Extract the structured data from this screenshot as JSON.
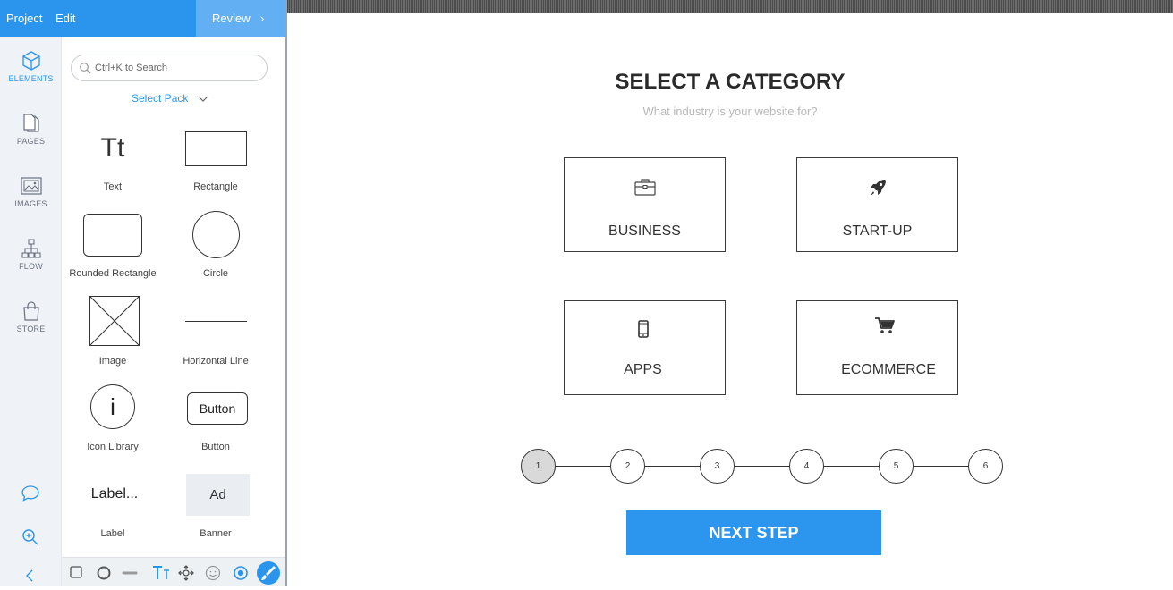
{
  "topbar": {
    "project_label": "Project",
    "edit_label": "Edit",
    "review_label": "Review"
  },
  "rail": {
    "items": [
      {
        "label": "ELEMENTS",
        "icon": "cube-icon",
        "active": true
      },
      {
        "label": "PAGES",
        "icon": "pages-icon"
      },
      {
        "label": "IMAGES",
        "icon": "image-icon"
      },
      {
        "label": "FLOW",
        "icon": "flow-icon"
      },
      {
        "label": "STORE",
        "icon": "bag-icon"
      }
    ],
    "tools": [
      "comment-icon",
      "zoom-icon",
      "collapse-icon"
    ]
  },
  "panel": {
    "search_placeholder": "Ctrl+K to Search",
    "select_pack": "Select Pack",
    "elements": [
      {
        "label": "Text",
        "glyph": "Tt"
      },
      {
        "label": "Rectangle"
      },
      {
        "label": "Rounded Rectangle"
      },
      {
        "label": "Circle"
      },
      {
        "label": "Image"
      },
      {
        "label": "Horizontal Line"
      },
      {
        "label": "Icon Library",
        "glyph": "i"
      },
      {
        "label": "Button",
        "glyph": "Button"
      },
      {
        "label": "Label",
        "glyph": "Label..."
      },
      {
        "label": "Banner",
        "glyph": "Ad"
      }
    ]
  },
  "bottombar": {
    "tools": [
      "square-icon",
      "circle-icon",
      "line-icon",
      "text-icon",
      "move-icon",
      "emoji-icon",
      "target-icon",
      "brush-icon"
    ]
  },
  "canvas": {
    "title": "SELECT A CATEGORY",
    "subtitle": "What industry is your website for?",
    "categories": [
      {
        "name": "BUSINESS",
        "icon": "briefcase-icon"
      },
      {
        "name": "START-UP",
        "icon": "rocket-icon"
      },
      {
        "name": "APPS",
        "icon": "mobile-icon"
      },
      {
        "name": "ECOMMERCE",
        "icon": "cart-icon"
      }
    ],
    "steps": [
      "1",
      "2",
      "3",
      "4",
      "5",
      "6"
    ],
    "current_step": 1,
    "next_button": "NEXT STEP"
  },
  "colors": {
    "accent": "#2b95ee",
    "review_bg": "#62b0f3",
    "rail_bg": "#eff2f6",
    "button": "#2c96ef"
  }
}
